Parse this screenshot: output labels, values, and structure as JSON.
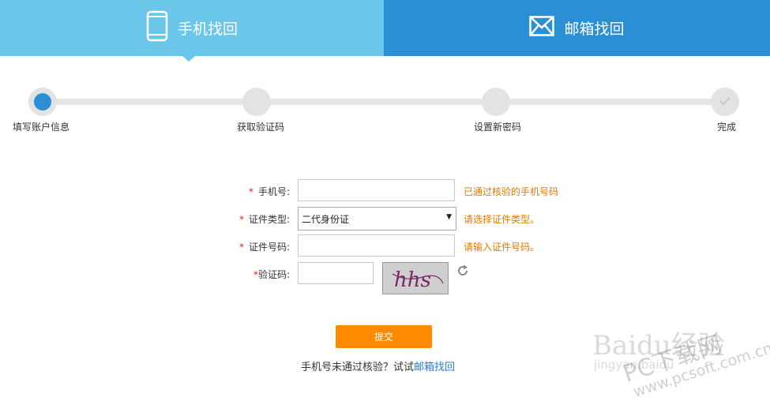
{
  "tabs": {
    "phone": {
      "label": "手机找回",
      "icon": "phone-icon"
    },
    "email": {
      "label": "邮箱找回",
      "icon": "envelope-icon"
    }
  },
  "steps": [
    {
      "label": "填写账户信息",
      "state": "active"
    },
    {
      "label": "获取验证码",
      "state": "pending"
    },
    {
      "label": "设置新密码",
      "state": "pending"
    },
    {
      "label": "完成",
      "state": "pending"
    }
  ],
  "form": {
    "phone": {
      "label": "手机号:",
      "value": "",
      "hint": "已通过核验的手机号码"
    },
    "id_type": {
      "label": "证件类型:",
      "selected": "二代身份证",
      "hint": "请选择证件类型。"
    },
    "id_number": {
      "label": "证件号码:",
      "value": "",
      "hint": "请输入证件号码。"
    },
    "captcha": {
      "label": "验证码:",
      "value": "",
      "image_text": "hhs"
    },
    "required_mark": "*"
  },
  "submit_label": "提交",
  "alt": {
    "text": "手机号未通过核验？试试",
    "link": "邮箱找回"
  },
  "watermark": {
    "baidu": "Baidu经验",
    "jing": "jingyan.baidu",
    "pc": "PC下载网",
    "url": "www.pcsoft.com.cn"
  },
  "colors": {
    "tab_phone": "#6ac7ea",
    "tab_email": "#2b8fd6",
    "active_step": "#2b8fd6",
    "hint": "#e07a00",
    "submit": "#ff8a00",
    "link": "#2b7bd0",
    "required": "#e02020"
  }
}
